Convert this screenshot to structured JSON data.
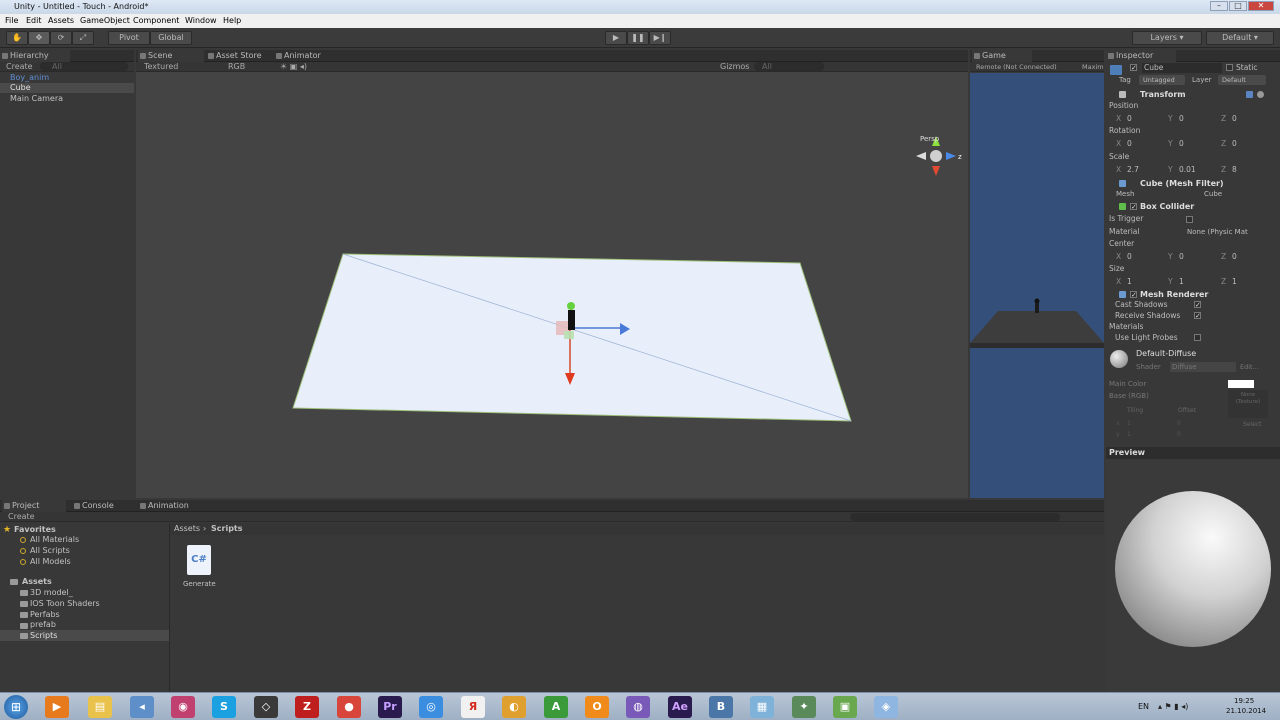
{
  "window": {
    "title": "Unity - Untitled - Touch - Android*"
  },
  "menu": [
    "File",
    "Edit",
    "Assets",
    "GameObject",
    "Component",
    "Window",
    "Help"
  ],
  "toolbar": {
    "pivot": "Pivot",
    "global": "Global",
    "layers": "Layers",
    "layout": "Default"
  },
  "hierarchy": {
    "tab": "Hierarchy",
    "create": "Create",
    "search_placeholder": "All",
    "items": [
      "Boy_anim",
      "Cube",
      "Main Camera"
    ]
  },
  "scene": {
    "tabs": [
      "Scene",
      "Asset Store",
      "Animator"
    ],
    "shading": "Textured",
    "render": "RGB",
    "gizmos": "Gizmos",
    "search_placeholder": "All",
    "persp": "Persp"
  },
  "game": {
    "tab": "Game",
    "display": "Remote (Not Connected)",
    "maximize": "Maxim"
  },
  "inspector": {
    "tab": "Inspector",
    "object_name": "Cube",
    "static": "Static",
    "tag_label": "Tag",
    "tag": "Untagged",
    "layer_label": "Layer",
    "layer": "Default",
    "transform": {
      "title": "Transform",
      "position_label": "Position",
      "rotation_label": "Rotation",
      "scale_label": "Scale",
      "position": [
        "0",
        "0",
        "0"
      ],
      "rotation": [
        "0",
        "0",
        "0"
      ],
      "scale": [
        "2.7",
        "0.01",
        "8"
      ]
    },
    "mesh_filter": {
      "title": "Cube (Mesh Filter)",
      "mesh_label": "Mesh",
      "mesh": "Cube"
    },
    "box_collider": {
      "title": "Box Collider",
      "is_trigger": "Is Trigger",
      "material_label": "Material",
      "material": "None (Physic Mat",
      "center_label": "Center",
      "center": [
        "0",
        "0",
        "0"
      ],
      "size_label": "Size",
      "size": [
        "1",
        "1",
        "1"
      ]
    },
    "mesh_renderer": {
      "title": "Mesh Renderer",
      "cast_shadows": "Cast Shadows",
      "receive_shadows": "Receive Shadows",
      "materials": "Materials",
      "use_light_probes": "Use Light Probes"
    },
    "material": {
      "name": "Default-Diffuse",
      "shader_label": "Shader",
      "shader": "Diffuse",
      "edit": "Edit...",
      "main_color": "Main Color",
      "base": "Base (RGB)",
      "tiling": "Tiling",
      "offset": "Offset",
      "none_texture": "None\n(Texture)",
      "select": "Select",
      "x": "x",
      "y": "y",
      "tx": "1",
      "ty": "1",
      "ox": "0",
      "oy": "0"
    },
    "axis_x": "X",
    "axis_y": "Y",
    "axis_z": "Z",
    "preview": "Preview"
  },
  "project": {
    "tabs": [
      "Project",
      "Console",
      "Animation"
    ],
    "create": "Create",
    "favorites_label": "Favorites",
    "favorites": [
      "All Materials",
      "All Scripts",
      "All Models"
    ],
    "assets_label": "Assets",
    "folders": [
      "3D model_",
      "IOS Toon Shaders",
      "Perfabs",
      "prefab",
      "Scripts"
    ],
    "breadcrumb": [
      "Assets",
      "Scripts"
    ],
    "files": [
      {
        "name": "Generate",
        "icon": "C#"
      }
    ]
  },
  "taskbar": {
    "lang": "EN",
    "time": "19:25",
    "date": "21.10.2014"
  }
}
